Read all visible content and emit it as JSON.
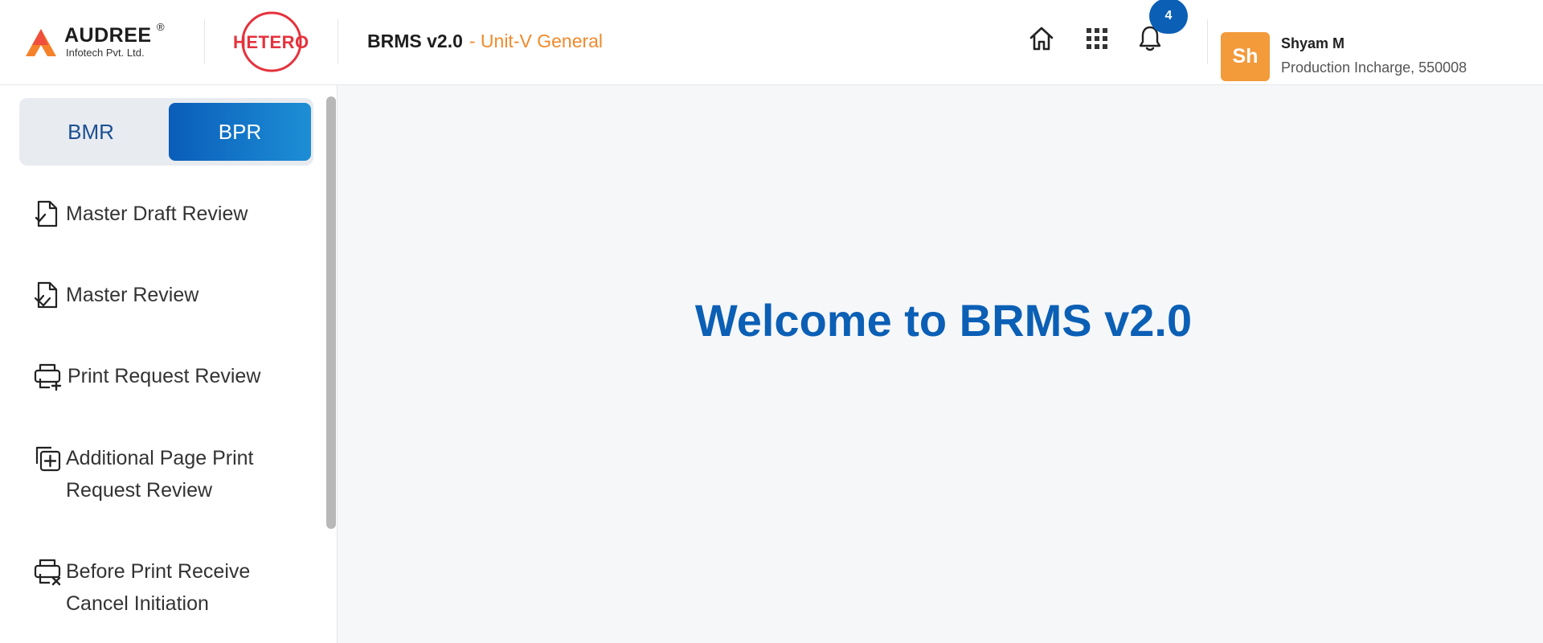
{
  "header": {
    "audree_logo": {
      "name": "AUDREE",
      "registered": "®",
      "tagline": "Infotech Pvt. Ltd."
    },
    "hetero_logo": {
      "name": "HETERO"
    },
    "app_title": "BRMS v2.0",
    "unit": "- Unit-V General",
    "icons": [
      "home-icon",
      "apps-grid-icon",
      "bell-icon"
    ],
    "notification_count": "4",
    "user": {
      "initials": "Sh",
      "name": "Shyam M",
      "role": "Production Incharge, 550008"
    }
  },
  "sidebar": {
    "toggle": {
      "options": [
        "BMR",
        "BPR"
      ],
      "selected": "BPR"
    },
    "items": [
      {
        "label": "Master Draft Review",
        "icon": "file-check-icon"
      },
      {
        "label": "Master Review",
        "icon": "file-double-check-icon"
      },
      {
        "label": "Print Request Review",
        "icon": "printer-add-icon"
      },
      {
        "label": "Additional Page Print Request Review",
        "icon": "copy-add-icon"
      },
      {
        "label": "Before Print Receive Cancel Initiation",
        "icon": "printer-cancel-icon"
      }
    ]
  },
  "main": {
    "welcome": "Welcome to BRMS v2.0"
  },
  "colors": {
    "brand_blue": "#0b5fb5",
    "accent_orange": "#f08a2c",
    "avatar_orange": "#f39a3b",
    "hetero_red": "#e5323d"
  }
}
